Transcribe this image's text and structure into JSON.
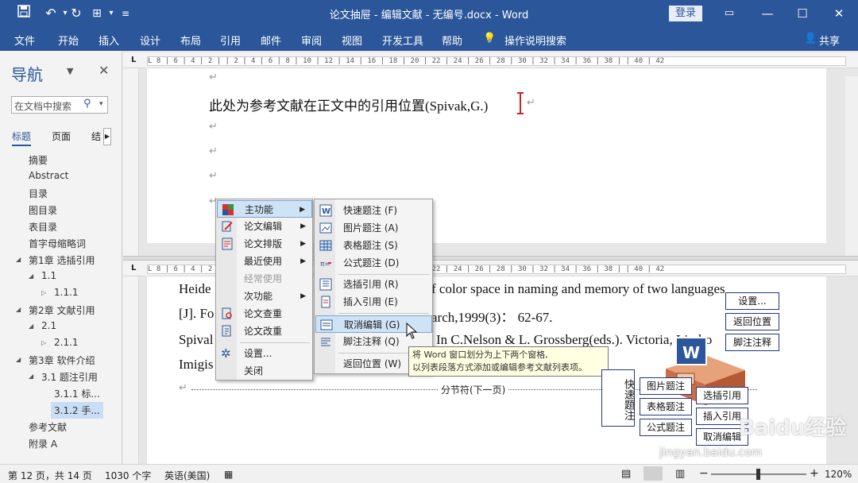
{
  "titlebar": {
    "title": "论文抽屉 - 编辑文献 - 无编号.docx - Word",
    "login": "登录",
    "save_icon": "save-icon",
    "undo_icon": "undo-icon",
    "redo_icon": "redo-icon"
  },
  "ribbon": {
    "tabs": [
      "文件",
      "开始",
      "插入",
      "设计",
      "布局",
      "引用",
      "邮件",
      "审阅",
      "视图",
      "开发工具",
      "帮助"
    ],
    "tell_me": "操作说明搜索",
    "share": "共享"
  },
  "nav": {
    "title": "导航",
    "search_placeholder": "在文档中搜索",
    "tabs": [
      "标题",
      "页面",
      "结"
    ],
    "items": [
      "摘要",
      "Abstract",
      "目录",
      "图目录",
      "表目录",
      "首字母缩略词",
      "第1章 选插引用",
      "1.1",
      "1.1.1",
      "第2章 文献引用",
      "2.1",
      "2.1.1",
      "第3章 软件介绍",
      "3.1 题注引用",
      "3.1.1 标...",
      "3.1.2 手...",
      "参考文献",
      "附录 A"
    ]
  },
  "ruler": {
    "top": "L  8 | 6 | 4 | 2 |   | 2 | 4 | 6 | 8 | 10 | 12 | 14 | 16 | 18 | 20 | 22 | 24 | 26 | 28 | 30 | 32 | 34 | 36 | 38 |   | 40 | 42",
    "bottom": "L  8 | 6 | 4 | 2 |   | 2 | 4 | 6 | 8 | 10 | 12 | 14 | 16 | 18 | 20 | 22 | 24 | 26 | 28 | 30 | 32 | 34 | 36 | 38 |   | 40 | 42"
  },
  "doc_top": {
    "line1": "此处为参考文献在正文中的引用位置(Spivak,G.)"
  },
  "doc_bottom": {
    "line1_left": "Heide",
    "line1_right": "f color space in naming and memory of two languages",
    "line2_left": "[J]. Fo",
    "line2_right": "arch,1999(3)： 62-67.",
    "line3_left": "Spival",
    "line3_right": "In C.Nelson & L. Grossberg(eds.). Victoria, Limbo",
    "line4_left": "Imigis",
    "section_break": "分节符(下一页)"
  },
  "menu_main": {
    "items": [
      "主功能",
      "论文编辑",
      "论文排版",
      "最近使用",
      "经常使用",
      "次功能",
      "论文查重",
      "论文改重",
      "设置...",
      "关闭"
    ]
  },
  "menu_sub": {
    "items": [
      "快速题注 (F)",
      "图片题注 (A)",
      "表格题注 (S)",
      "公式题注 (D)",
      "选插引用 (R)",
      "插入引用 (E)",
      "取消编辑 (G)",
      "脚注注释 (Q)",
      "返回位置 (W)"
    ]
  },
  "tooltip": {
    "line1": "将 Word 窗口划分为上下两个窗格,",
    "line2": "以列表段落方式添加或编辑参考文献列表项。"
  },
  "floating": {
    "settings": "设置...",
    "return_pos": "返回位置",
    "footnote": "脚注注释",
    "quick_caption": "快速题注",
    "pic_caption": "图片题注",
    "table_caption": "表格题注",
    "formula_caption": "公式题注",
    "select_cite": "选插引用",
    "insert_cite": "插入引用",
    "cancel_edit": "取消编辑",
    "word_icon": "W"
  },
  "status": {
    "page": "第 12 页，共 14 页",
    "words": "1030 个字",
    "lang": "英语(美国)",
    "zoom": "120%"
  },
  "watermark": {
    "brand": "Baidu经验",
    "url": "jingyan.baidu.com"
  }
}
